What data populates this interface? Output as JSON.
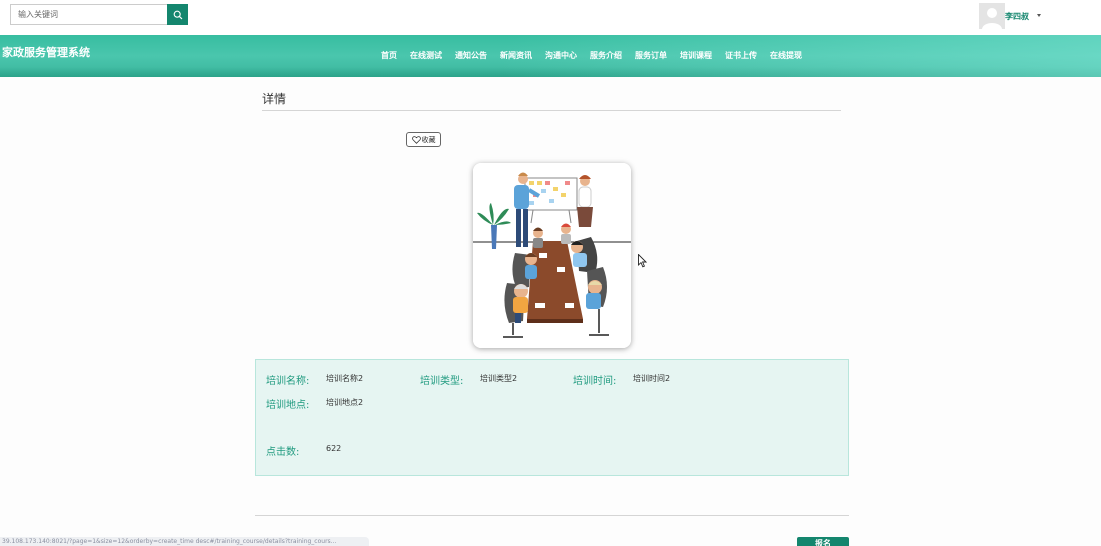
{
  "search": {
    "placeholder": "输入关键词",
    "icon": "search-icon"
  },
  "user": {
    "name": "李四叔",
    "avatar_icon": "avatar-icon"
  },
  "site": {
    "title": "家政服务管理系统"
  },
  "nav": {
    "items": [
      "首页",
      "在线测试",
      "通知公告",
      "新闻资讯",
      "沟通中心",
      "服务介绍",
      "服务订单",
      "培训课程",
      "证书上传",
      "在线提现"
    ]
  },
  "detail": {
    "section_title": "详情",
    "favorite_label": "收藏",
    "fields": [
      {
        "label": "培训名称:",
        "value": "培训名称2"
      },
      {
        "label": "培训类型:",
        "value": "培训类型2"
      },
      {
        "label": "培训时间:",
        "value": "培训时间2"
      },
      {
        "label": "培训地点:",
        "value": "培训地点2"
      },
      {
        "label": "点击数:",
        "value": "622"
      }
    ],
    "signup_label": "报名"
  },
  "status_bar": {
    "url": "39.108.173.140:8021/?page=1&size=12&orderby=create_time desc#/training_course/details?training_cours..."
  },
  "colors": {
    "accent": "#14866e",
    "nav_band": "#37bda0",
    "label_green": "#1f9a7f",
    "panel_bg": "#e6f5f2"
  }
}
